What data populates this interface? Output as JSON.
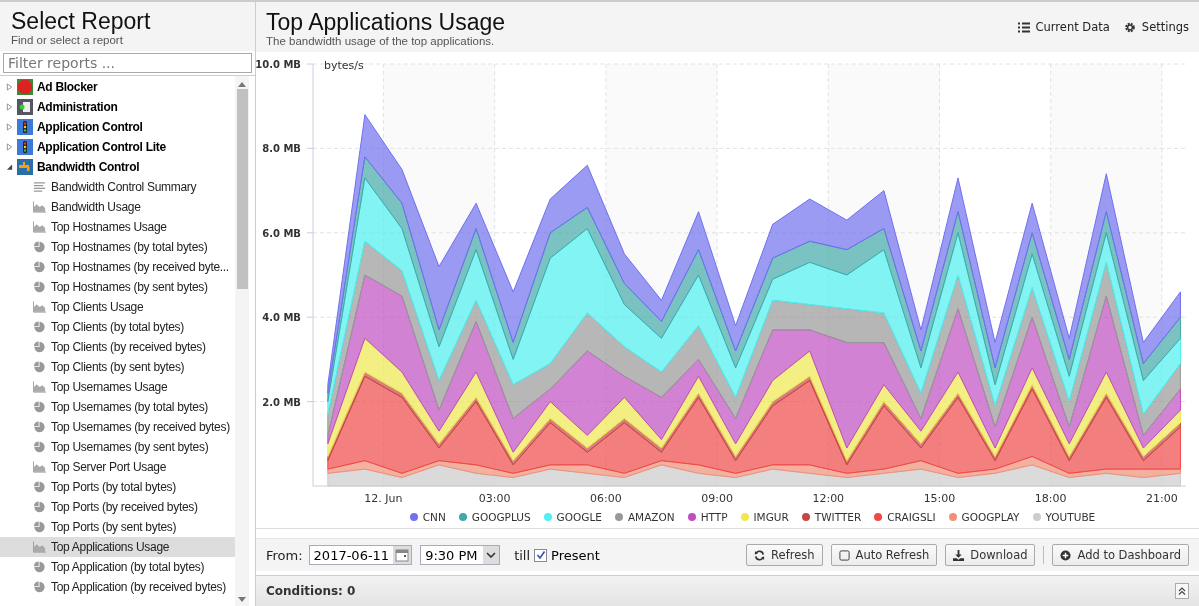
{
  "sidebar": {
    "title": "Select Report",
    "subtitle": "Find or select a report",
    "filter": {
      "placeholder": "Filter reports ..."
    },
    "reports": [
      {
        "label": "Ad Blocker",
        "kind": "adblock",
        "expanded": false
      },
      {
        "label": "Administration",
        "kind": "admin",
        "expanded": false
      },
      {
        "label": "Application Control",
        "kind": "appcontrol",
        "expanded": false
      },
      {
        "label": "Application Control Lite",
        "kind": "appcontrol",
        "expanded": false
      },
      {
        "label": "Bandwidth Control",
        "kind": "bandwidth",
        "expanded": true,
        "children": [
          {
            "label": "Bandwidth Control Summary",
            "kind": "summary",
            "selected": false
          },
          {
            "label": "Bandwidth Usage",
            "kind": "area",
            "selected": false
          },
          {
            "label": "Top Hostnames Usage",
            "kind": "area",
            "selected": false
          },
          {
            "label": "Top Hostnames (by total bytes)",
            "kind": "pie",
            "selected": false
          },
          {
            "label": "Top Hostnames (by received byte...",
            "kind": "pie",
            "selected": false
          },
          {
            "label": "Top Hostnames (by sent bytes)",
            "kind": "pie",
            "selected": false
          },
          {
            "label": "Top Clients Usage",
            "kind": "area",
            "selected": false
          },
          {
            "label": "Top Clients (by total bytes)",
            "kind": "pie",
            "selected": false
          },
          {
            "label": "Top Clients (by received bytes)",
            "kind": "pie",
            "selected": false
          },
          {
            "label": "Top Clients (by sent bytes)",
            "kind": "pie",
            "selected": false
          },
          {
            "label": "Top Usernames Usage",
            "kind": "area",
            "selected": false
          },
          {
            "label": "Top Usernames (by total bytes)",
            "kind": "pie",
            "selected": false
          },
          {
            "label": "Top Usernames (by received bytes)",
            "kind": "pie",
            "selected": false
          },
          {
            "label": "Top Usernames (by sent bytes)",
            "kind": "pie",
            "selected": false
          },
          {
            "label": "Top Server Port Usage",
            "kind": "area",
            "selected": false
          },
          {
            "label": "Top Ports (by total bytes)",
            "kind": "pie",
            "selected": false
          },
          {
            "label": "Top Ports (by received bytes)",
            "kind": "pie",
            "selected": false
          },
          {
            "label": "Top Ports (by sent bytes)",
            "kind": "pie",
            "selected": false
          },
          {
            "label": "Top Applications Usage",
            "kind": "area",
            "selected": true
          },
          {
            "label": "Top Application (by total bytes)",
            "kind": "pie",
            "selected": false
          },
          {
            "label": "Top Application (by received bytes)",
            "kind": "pie",
            "selected": false
          }
        ]
      }
    ]
  },
  "report": {
    "title": "Top Applications Usage",
    "subtitle": "The bandwidth usage of the top applications.",
    "actions": [
      {
        "label": "Current Data",
        "kind": "list"
      },
      {
        "label": "Settings",
        "kind": "gear"
      }
    ],
    "chart_data": {
      "type": "area",
      "stacked": true,
      "grid": true,
      "legend": true,
      "ylabel": "bytes/s",
      "xlim": [
        -1.9,
        21.65
      ],
      "ylim": [
        0,
        10
      ],
      "x": [
        -1.5,
        -0.5,
        0.5,
        1.5,
        2.5,
        3.5,
        4.5,
        5.5,
        6.5,
        7.5,
        8.5,
        9.5,
        10.5,
        11.5,
        12.5,
        13.5,
        14.5,
        15.5,
        16.5,
        17.5,
        18.5,
        19.5,
        20.5,
        21.5
      ],
      "xticks": [
        {
          "value": 0,
          "label": "12. Jun"
        },
        {
          "value": 3,
          "label": "03:00"
        },
        {
          "value": 6,
          "label": "06:00"
        },
        {
          "value": 9,
          "label": "09:00"
        },
        {
          "value": 12,
          "label": "12:00"
        },
        {
          "value": 15,
          "label": "15:00"
        },
        {
          "value": 18,
          "label": "18:00"
        },
        {
          "value": 21,
          "label": "21:00"
        }
      ],
      "yticks": [
        {
          "value": 2,
          "label": "2.0 MB"
        },
        {
          "value": 4,
          "label": "4.0 MB"
        },
        {
          "value": 6,
          "label": "6.0 MB"
        },
        {
          "value": 8,
          "label": "8.0 MB"
        },
        {
          "value": 10,
          "label": "10.0 MB"
        }
      ],
      "series": [
        {
          "name": "CNN",
          "color": "#7070f0",
          "values": [
            0.2,
            1.0,
            0.8,
            1.5,
            0.6,
            1.2,
            0.8,
            1.0,
            0.7,
            0.5,
            0.9,
            0.6,
            0.8,
            1.0,
            0.7,
            0.9,
            0.5,
            0.8,
            0.6,
            0.7,
            0.5,
            0.9,
            0.5,
            0.6
          ]
        },
        {
          "name": "GOOGPLUS",
          "color": "#43a8a8",
          "values": [
            0.2,
            0.5,
            0.6,
            0.4,
            0.5,
            0.4,
            0.6,
            0.5,
            0.5,
            0.4,
            0.6,
            0.4,
            0.5,
            0.5,
            0.6,
            0.5,
            0.4,
            0.5,
            0.4,
            0.5,
            0.4,
            0.5,
            0.4,
            0.5
          ]
        },
        {
          "name": "GOOGLE",
          "color": "#4ef0f0",
          "values": [
            0.3,
            1.5,
            1.0,
            0.8,
            1.2,
            0.6,
            2.5,
            2.0,
            1.0,
            0.8,
            1.2,
            0.7,
            0.5,
            1.0,
            0.8,
            1.5,
            0.6,
            1.0,
            0.5,
            0.8,
            0.6,
            0.7,
            0.8,
            0.6
          ]
        },
        {
          "name": "AMAZON",
          "color": "#999999",
          "values": [
            0.5,
            0.8,
            0.6,
            0.7,
            0.5,
            0.8,
            0.6,
            0.9,
            0.7,
            0.6,
            0.8,
            0.5,
            0.7,
            0.6,
            0.8,
            0.7,
            0.6,
            0.8,
            0.5,
            0.7,
            0.6,
            0.8,
            0.5,
            0.6
          ]
        },
        {
          "name": "HTTP",
          "color": "#c04ec0",
          "values": [
            0.2,
            1.5,
            1.8,
            0.5,
            1.2,
            0.8,
            0.3,
            2.0,
            0.5,
            1.0,
            0.4,
            0.6,
            1.2,
            0.5,
            2.5,
            1.0,
            0.3,
            1.5,
            0.5,
            1.2,
            0.4,
            1.8,
            0.3,
            0.5
          ]
        },
        {
          "name": "IMGUR",
          "color": "#f0e84e",
          "values": [
            0.3,
            0.8,
            0.5,
            0.3,
            0.6,
            0.2,
            0.4,
            0.3,
            0.5,
            0.2,
            0.4,
            0.3,
            0.5,
            0.6,
            0.3,
            0.4,
            0.3,
            0.5,
            0.2,
            0.4,
            0.3,
            0.5,
            0.2,
            0.3
          ]
        },
        {
          "name": "TWITTER",
          "color": "#c44848",
          "values": [
            0.1,
            0.1,
            0.1,
            0.1,
            0.1,
            0.1,
            0.1,
            0.1,
            0.1,
            0.1,
            0.1,
            0.1,
            0.1,
            0.1,
            0.1,
            0.1,
            0.1,
            0.1,
            0.1,
            0.1,
            0.1,
            0.1,
            0.1,
            0.1
          ]
        },
        {
          "name": "CRAIGSLI",
          "color": "#f04848",
          "values": [
            0.2,
            2.0,
            1.8,
            0.3,
            1.5,
            0.2,
            1.0,
            0.3,
            1.2,
            0.2,
            1.6,
            0.3,
            1.4,
            2.0,
            0.2,
            1.5,
            0.3,
            1.8,
            0.2,
            1.6,
            0.3,
            1.7,
            0.2,
            1.0
          ]
        },
        {
          "name": "GOOGPLAY",
          "color": "#f09078",
          "values": [
            0.1,
            0.2,
            0.1,
            0.1,
            0.2,
            0.1,
            0.1,
            0.2,
            0.1,
            0.1,
            0.2,
            0.1,
            0.1,
            0.2,
            0.1,
            0.1,
            0.2,
            0.1,
            0.1,
            0.2,
            0.1,
            0.1,
            0.2,
            0.1
          ]
        },
        {
          "name": "YOUTUBE",
          "color": "#cccccc",
          "values": [
            0.3,
            0.4,
            0.2,
            0.5,
            0.3,
            0.2,
            0.4,
            0.3,
            0.2,
            0.5,
            0.3,
            0.2,
            0.4,
            0.3,
            0.2,
            0.3,
            0.4,
            0.2,
            0.3,
            0.5,
            0.2,
            0.3,
            0.2,
            0.3
          ]
        }
      ]
    }
  },
  "toolbar": {
    "from_label": "From:",
    "date": "2017-06-11",
    "time": "9:30 PM",
    "till_label": "till",
    "present": {
      "label": "Present",
      "checked": true
    },
    "buttons": [
      {
        "label": "Refresh",
        "kind": "refresh"
      },
      {
        "label": "Auto Refresh",
        "kind": "checkbox"
      },
      {
        "label": "Download",
        "kind": "download"
      },
      {
        "label": "Add to Dashboard",
        "kind": "add"
      }
    ]
  },
  "conditions": {
    "label": "Conditions: 0"
  }
}
